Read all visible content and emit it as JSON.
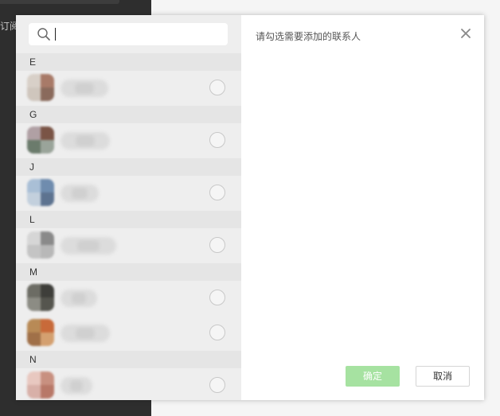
{
  "background": {
    "sidebar_label": "订阅"
  },
  "dialog": {
    "title": "请勾选需要添加的联系人",
    "confirm_label": "确定",
    "cancel_label": "取消",
    "close_icon": "close-icon",
    "search_icon": "search-icon"
  },
  "contacts": {
    "groups": [
      {
        "letter": "E",
        "items": [
          {
            "avatar_colors": [
              "#d8d0c8",
              "#a87a68",
              "#cfc6bd",
              "#8a6a5c"
            ],
            "name_width": 60
          }
        ]
      },
      {
        "letter": "G",
        "items": [
          {
            "avatar_colors": [
              "#b0a0a4",
              "#7a5446",
              "#6b7b6c",
              "#9aa49a"
            ],
            "name_width": 62
          }
        ]
      },
      {
        "letter": "J",
        "items": [
          {
            "avatar_colors": [
              "#a9bfd6",
              "#6f8cae",
              "#c3d0dd",
              "#5d7390"
            ],
            "name_width": 48
          }
        ]
      },
      {
        "letter": "L",
        "items": [
          {
            "avatar_colors": [
              "#d6d6d6",
              "#8a8a8a",
              "#c4c4c4",
              "#b8b8b8"
            ],
            "name_width": 70
          }
        ]
      },
      {
        "letter": "M",
        "items": [
          {
            "avatar_colors": [
              "#6c6c64",
              "#3e3e3a",
              "#8c8c84",
              "#55554e"
            ],
            "name_width": 46
          },
          {
            "avatar_colors": [
              "#b88a56",
              "#c86a3a",
              "#a07048",
              "#d4a070"
            ],
            "name_width": 62
          }
        ]
      },
      {
        "letter": "N",
        "items": [
          {
            "avatar_colors": [
              "#e8c8c0",
              "#c89080",
              "#d8b0a8",
              "#b87868"
            ],
            "name_width": 40
          }
        ]
      }
    ]
  }
}
